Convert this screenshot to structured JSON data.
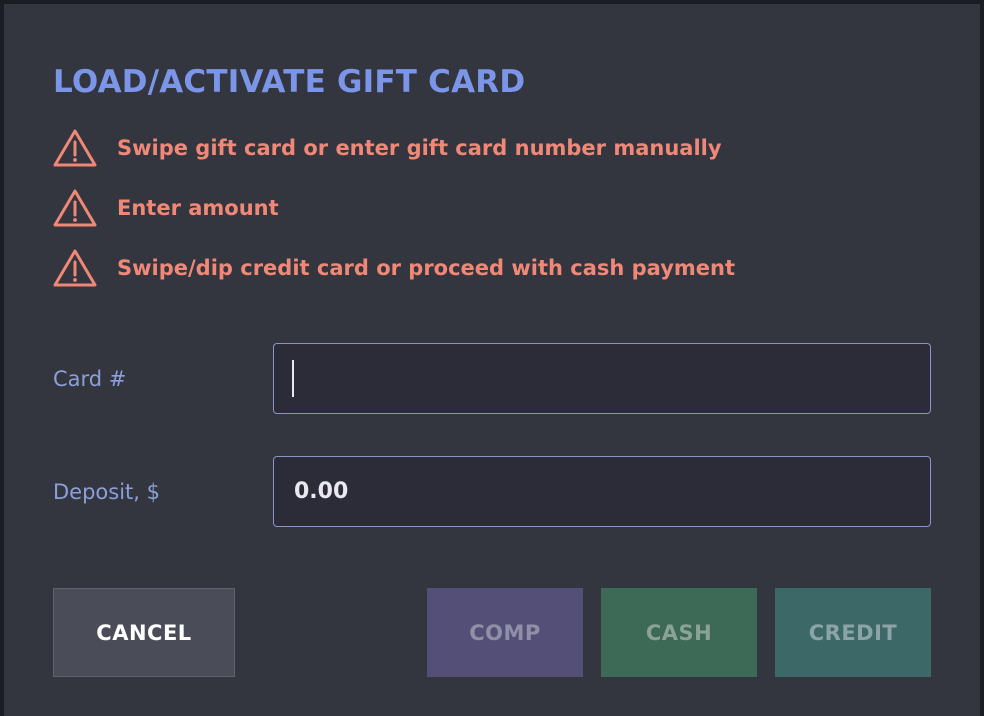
{
  "dialog": {
    "title": "LOAD/ACTIVATE GIFT CARD",
    "warnings": [
      {
        "icon": "warning-triangle-icon",
        "text": "Swipe gift card or enter gift card number manually"
      },
      {
        "icon": "warning-triangle-icon",
        "text": "Enter amount"
      },
      {
        "icon": "warning-triangle-icon",
        "text": "Swipe/dip credit card or proceed with cash payment"
      }
    ],
    "card_field": {
      "label": "Card #",
      "value": "",
      "placeholder": ""
    },
    "deposit_field": {
      "label": "Deposit, $",
      "value": "0.00"
    },
    "buttons": {
      "cancel": "CANCEL",
      "comp": "COMP",
      "cash": "CASH",
      "credit": "CREDIT"
    }
  },
  "colors": {
    "title": "#7b96e8",
    "warning": "#f08878",
    "label": "#8c9fd8",
    "dialog_bg": "#33353f",
    "field_border": "#8d93c5",
    "cancel_bg": "#4a4d58",
    "comp_bg": "#544f76",
    "cash_bg": "#3d6957",
    "credit_bg": "#3d6868"
  }
}
